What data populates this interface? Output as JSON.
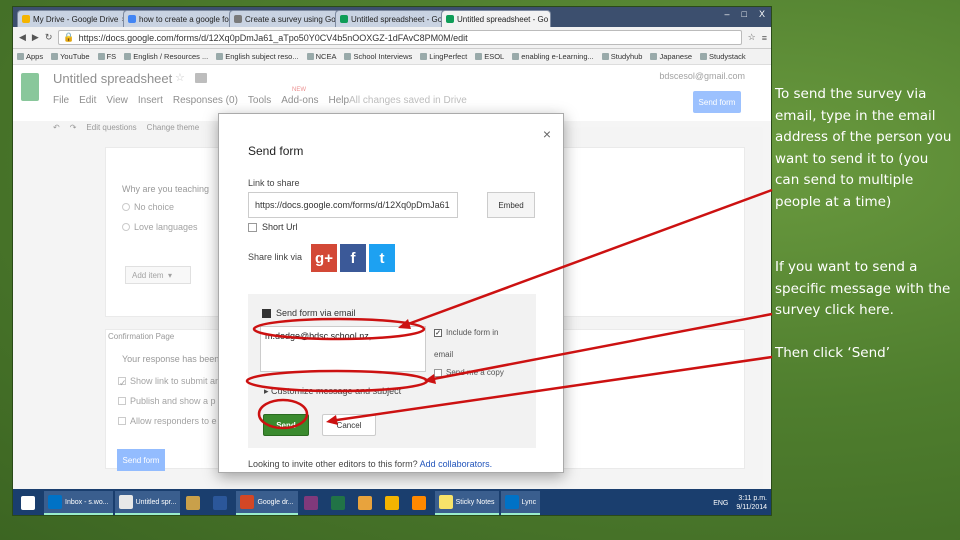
{
  "browser": {
    "tabs": [
      {
        "label": "My Drive - Google Drive",
        "color": "#f4b400",
        "active": false
      },
      {
        "label": "how to create a google fo",
        "color": "#4285f4",
        "active": false
      },
      {
        "label": "Create a survey using Go",
        "color": "#7a7a7a",
        "active": false
      },
      {
        "label": "Untitled spreadsheet - Go",
        "color": "#0f9d58",
        "active": false
      },
      {
        "label": "Untitled spreadsheet - Go",
        "color": "#0f9d58",
        "active": true
      }
    ],
    "window_buttons": [
      "–",
      "□",
      "X"
    ],
    "url": "https://docs.google.com/forms/d/12Xq0pDmJa61_aTpo50Y0CV4b5nOOXGZ-1dFAvC8PM0M/edit",
    "bookmarks": [
      "Apps",
      "YouTube",
      "FS",
      "English / Resources ...",
      "English subject reso...",
      "NCEA",
      "School Interviews",
      "LingPerfect",
      "ESOL",
      "enabling e-Learning...",
      "Studyhub",
      "Japanese",
      "Studystack"
    ]
  },
  "docs": {
    "title": "Untitled spreadsheet",
    "menus": [
      "File",
      "Edit",
      "View",
      "Insert",
      "Responses (0)",
      "Tools",
      "Add-ons",
      "Help"
    ],
    "new_badge": "NEW",
    "saved": "All changes saved in Drive",
    "account": "bdscesol@gmail.com",
    "send_form_top": "Send form",
    "toolbar": [
      "Edit questions",
      "Change theme"
    ],
    "question": "Why are you teaching",
    "options": [
      "No choice",
      "Love languages"
    ],
    "add_item": "Add item",
    "confirmation": "Confirmation Page",
    "response_text": "Your response has been",
    "checks": [
      "Show link to submit an",
      "Publish and show a p",
      "Allow responders to e"
    ],
    "send_form_bottom": "Send form"
  },
  "dialog": {
    "title": "Send form",
    "close": "×",
    "link_label": "Link to share",
    "link": "https://docs.google.com/forms/d/12Xq0pDmJa61",
    "embed": "Embed",
    "short_url": "Short Url",
    "share_via": "Share link via",
    "social": {
      "gplus": "g+",
      "facebook": "f",
      "twitter": "t"
    },
    "email_section": "Send form via email",
    "to_value": "m.dodge@bdsc.school.nz,",
    "include_form": "Include form in",
    "include_form_cont": "email",
    "send_me_copy": "Send me a copy",
    "customize": "Customize message and subject",
    "send": "Send",
    "cancel": "Cancel",
    "collab_text": "Looking to invite other editors to this form?",
    "collab_link": "Add collaborators."
  },
  "taskbar": {
    "items": [
      {
        "label": "",
        "color": "#fff"
      },
      {
        "label": "Inbox - s.wo...",
        "color": "#0072c6"
      },
      {
        "label": "Untitled spr...",
        "color": "#e8e8e8"
      },
      {
        "label": "",
        "color": "#c9a04a"
      },
      {
        "label": "",
        "color": "#2b579a"
      },
      {
        "label": "Google dr...",
        "color": "#d24726"
      },
      {
        "label": "",
        "color": "#80397b"
      },
      {
        "label": "",
        "color": "#217346"
      },
      {
        "label": "",
        "color": "#e8a33d"
      },
      {
        "label": "",
        "color": "#f4b400"
      },
      {
        "label": "",
        "color": "#ff8800"
      },
      {
        "label": "Sticky Notes",
        "color": "#f7e36a"
      },
      {
        "label": "Lync",
        "color": "#0072c6"
      }
    ],
    "lang": "ENG",
    "time": "3:11 p.m.",
    "date": "9/11/2014"
  },
  "annotations": {
    "note1": "To send the survey via email, type in the email address of the person you want to send it to (you can send to multiple people at a time)",
    "note2": "If you want to send a specific message with the survey click here.",
    "note3": "Then click ‘Send’"
  }
}
